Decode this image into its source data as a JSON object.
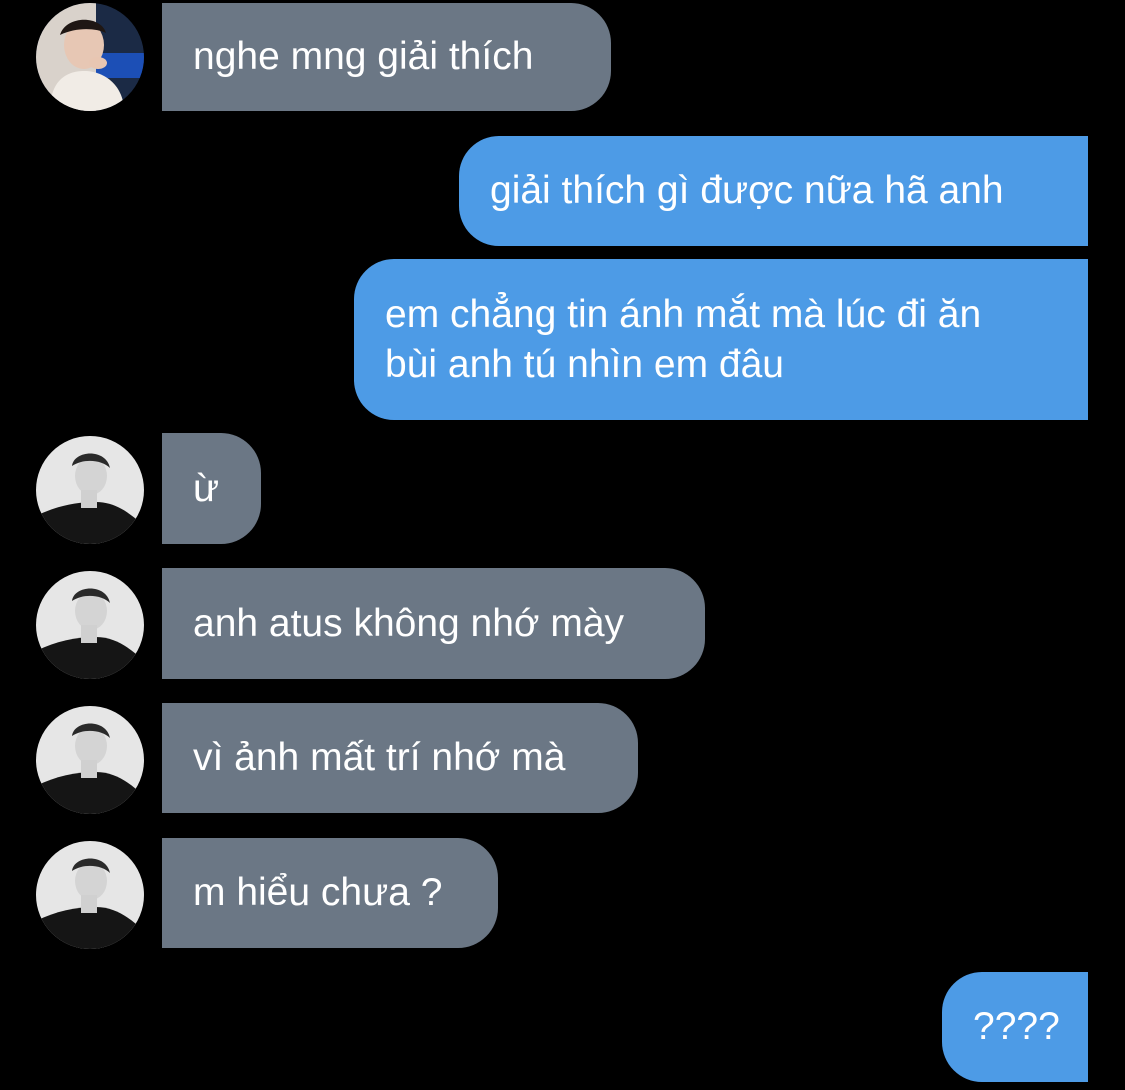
{
  "messages": [
    {
      "side": "in",
      "text": "nghe mng giải thích",
      "avatar": "avatar-warm-icon"
    },
    {
      "side": "out",
      "text": "giải thích gì được nữa hã anh"
    },
    {
      "side": "out",
      "text": "em chẳng tin ánh mắt mà lúc đi ăn bùi anh tú nhìn em đâu"
    },
    {
      "side": "in",
      "text": "ừ",
      "avatar": "avatar-bw-icon"
    },
    {
      "side": "in",
      "text": "anh atus không nhớ mày",
      "avatar": "avatar-bw-icon"
    },
    {
      "side": "in",
      "text": "vì ảnh mất trí nhớ mà",
      "avatar": "avatar-bw-icon"
    },
    {
      "side": "in",
      "text": "m hiểu chưa ?",
      "avatar": "avatar-bw-icon"
    },
    {
      "side": "out",
      "text": "????"
    }
  ],
  "colors": {
    "incoming": "#6b7785",
    "outgoing": "#4d9be6",
    "background": "#000000"
  }
}
